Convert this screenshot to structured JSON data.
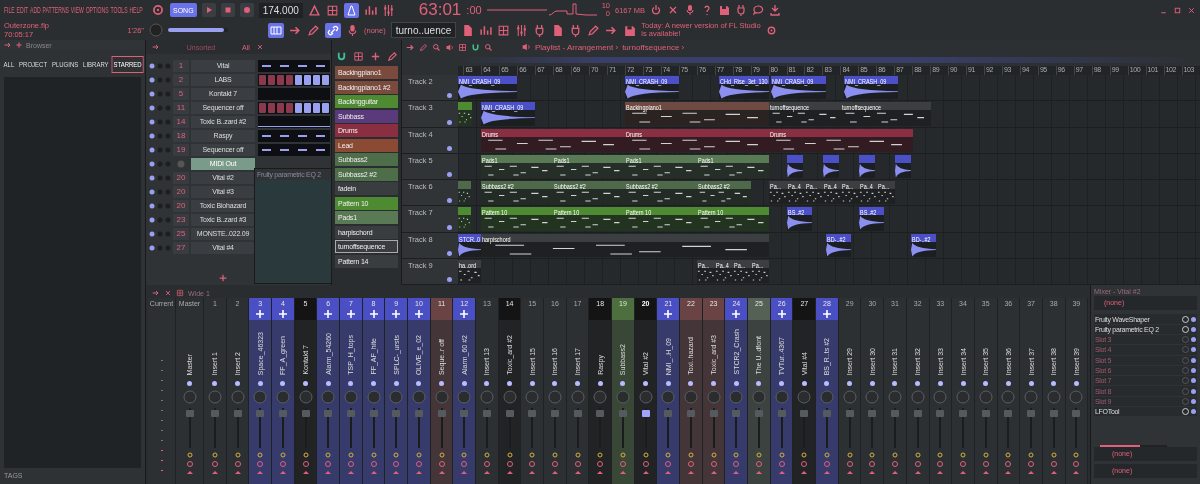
{
  "menu": [
    "FILE",
    "EDIT",
    "ADD",
    "PATTERNS",
    "VIEW",
    "OPTIONS",
    "TOOLS",
    "HELP"
  ],
  "transport": {
    "mode": "SONG",
    "tempo": "174.000"
  },
  "time": {
    "main": "63:01",
    "ticks": ":00"
  },
  "cpu": {
    "value": "10",
    "memory": "6167 MB",
    "polyphony": "0"
  },
  "project": {
    "file": "Outerzone.flp",
    "time": "70:05:17",
    "length": "1'26\""
  },
  "master_volume": {
    "level": 0.93
  },
  "pattern_picker": {
    "channel": "(none)",
    "pattern": "turno..uence"
  },
  "news": "Today: A newer version of FL Studio is available!",
  "browser": {
    "title": "Browser",
    "tabs": [
      {
        "label": "ALL",
        "selected": false
      },
      {
        "label": "PROJECT",
        "selected": false
      },
      {
        "label": "PLUGINS",
        "selected": false
      },
      {
        "label": "LIBRARY",
        "selected": false
      },
      {
        "label": "STARRED",
        "selected": true
      }
    ],
    "footer": "TAGS"
  },
  "rack": {
    "filter": "Unsorted",
    "group": "All",
    "plugin_window": {
      "title": "Fruity parametric EQ 2"
    },
    "channels": [
      {
        "number": "1",
        "name": "Vital",
        "selected": false
      },
      {
        "number": "2",
        "name": "LABS",
        "selected": false
      },
      {
        "number": "5",
        "name": "Kontakt 7",
        "selected": false
      },
      {
        "number": "11",
        "name": "Sequencer off",
        "selected": false
      },
      {
        "number": "14",
        "name": "Toxic B..zard #2",
        "selected": false
      },
      {
        "number": "18",
        "name": "Raspy",
        "selected": false
      },
      {
        "number": "19",
        "name": "Sequencer off",
        "selected": false
      },
      {
        "name": "MIDI Out",
        "selected": true
      },
      {
        "number": "20",
        "name": "Vital #2",
        "selected": false
      },
      {
        "number": "20",
        "name": "Vital #3",
        "selected": false
      },
      {
        "number": "20",
        "name": "Toxic Biohazard",
        "selected": false
      },
      {
        "number": "23",
        "name": "Toxic B..zard #3",
        "selected": false
      },
      {
        "number": "25",
        "name": "MONSTE..022.09",
        "selected": false
      },
      {
        "number": "27",
        "name": "Vital #4",
        "selected": false
      }
    ]
  },
  "patterns": {
    "items": [
      {
        "name": "Backingpiano1",
        "color": "#7a4a3c",
        "selected": false
      },
      {
        "name": "Backingpiano1 #2",
        "color": "#7a4a3c",
        "selected": false
      },
      {
        "name": "Backingguitar",
        "color": "#4e8a32",
        "selected": false
      },
      {
        "name": "Subbass",
        "color": "#5a3a7a",
        "selected": false
      },
      {
        "name": "Drums",
        "color": "#8a2f42",
        "selected": false
      },
      {
        "name": "Lead",
        "color": "#8a4a34",
        "selected": false
      },
      {
        "name": "Subbass2",
        "color": "#4e6e4a",
        "selected": false
      },
      {
        "name": "Subbass2 #2",
        "color": "#4e6e4a",
        "selected": false
      },
      {
        "name": "fadein",
        "color": "#3a3d40",
        "selected": false
      },
      {
        "name": "Pattern 10",
        "color": "#4e8a32",
        "selected": false
      },
      {
        "name": "Pads1",
        "color": "#5a7a56",
        "selected": false
      },
      {
        "name": "harpischord",
        "color": "#3a3d40",
        "selected": false
      },
      {
        "name": "turnoffsequence",
        "color": "#3a3d40",
        "selected": true
      },
      {
        "name": "Pattern 14",
        "color": "#3a3d40",
        "selected": false
      }
    ]
  },
  "playlist": {
    "title": "Playlist - Arrangement ›",
    "pattern": "turnoffsequence ›",
    "ruler": [
      "63",
      "64",
      "65",
      "66",
      "67",
      "68",
      "69",
      "70",
      "71",
      "72",
      "73",
      "74",
      "75",
      "76",
      "77",
      "78",
      "79",
      "80",
      "81",
      "82",
      "83",
      "84",
      "85",
      "86",
      "87",
      "88",
      "89",
      "90",
      "91",
      "92",
      "93",
      "94",
      "95",
      "96",
      "97",
      "98",
      "99",
      "100",
      "101",
      "102",
      "103"
    ],
    "tracks": [
      {
        "name": "Track 2",
        "clips": [
          {
            "kind": "audio",
            "name": "NMI_CRASH_09",
            "color": "#4b4fc8"
          },
          {
            "kind": "audio",
            "name": "NMI_CRASH_09",
            "color": "#4b4fc8"
          },
          {
            "kind": "audio",
            "name": "CHd_Rise_3et_130",
            "color": "#4b4fc8"
          },
          {
            "kind": "audio",
            "name": "NMI_CRASH_09",
            "color": "#4b4fc8"
          },
          {
            "kind": "audio",
            "name": "NMI_CRASH_09",
            "color": "#4b4fc8"
          }
        ]
      },
      {
        "name": "Track 3",
        "clips": [
          {
            "kind": "pattern",
            "color": "#4e8a32"
          },
          {
            "kind": "audio",
            "name": "NMI_CRASH_09",
            "color": "#4b4fc8"
          },
          {
            "kind": "pattern",
            "name": "Backingpiano1",
            "color": "#6e4a42"
          },
          {
            "kind": "pattern",
            "name": "turnoffsequence",
            "color": "#3c3f42"
          },
          {
            "kind": "pattern",
            "name": "turnoffsequence",
            "color": "#3c3f42"
          }
        ]
      },
      {
        "name": "Track 4",
        "clips": [
          {
            "kind": "pattern",
            "name": "Drums",
            "color": "#8a2f42"
          },
          {
            "kind": "pattern",
            "name": "Drums",
            "color": "#8a2f42"
          },
          {
            "kind": "pattern",
            "name": "Drums",
            "color": "#8a2f42"
          }
        ]
      },
      {
        "name": "Track 5",
        "clips": [
          {
            "kind": "pattern",
            "name": "Pads1",
            "color": "#5a7a56"
          },
          {
            "kind": "pattern",
            "name": "Pads1",
            "color": "#5a7a56"
          },
          {
            "kind": "pattern",
            "name": "Pads1",
            "color": "#5a7a56"
          },
          {
            "kind": "pattern",
            "name": "Pads1",
            "color": "#5a7a56"
          },
          {
            "kind": "audio",
            "color": "#4b4fc8"
          },
          {
            "kind": "audio",
            "color": "#4b4fc8"
          },
          {
            "kind": "audio",
            "color": "#4b4fc8"
          },
          {
            "kind": "audio",
            "color": "#4b4fc8"
          }
        ]
      },
      {
        "name": "Track 6",
        "clips": [
          {
            "kind": "pattern",
            "color": "#4e6a4a"
          },
          {
            "kind": "pattern",
            "name": "Subbass2 #2",
            "color": "#4e6a4a"
          },
          {
            "kind": "pattern",
            "name": "Subbass2 #2",
            "color": "#4e6a4a"
          },
          {
            "kind": "pattern",
            "name": "Subbass2 #2",
            "color": "#4e6a4a"
          },
          {
            "kind": "pattern",
            "name": "Subbass2 #2",
            "color": "#4e6a4a"
          },
          {
            "kind": "pattern",
            "name": "Pa...",
            "color": "#3c3f42"
          },
          {
            "kind": "pattern",
            "name": "Pa..4",
            "color": "#3c3f42"
          },
          {
            "kind": "pattern",
            "name": "Pa...",
            "color": "#3c3f42"
          },
          {
            "kind": "pattern",
            "name": "Pa..4",
            "color": "#3c3f42"
          },
          {
            "kind": "pattern",
            "name": "Pa...",
            "color": "#3c3f42"
          },
          {
            "kind": "pattern",
            "name": "Pa..4",
            "color": "#3c3f42"
          },
          {
            "kind": "pattern",
            "name": "Pa...",
            "color": "#3c3f42"
          }
        ]
      },
      {
        "name": "Track 7",
        "clips": [
          {
            "kind": "pattern",
            "color": "#4e8a32"
          },
          {
            "kind": "pattern",
            "name": "Pattern 10",
            "color": "#4e8a32"
          },
          {
            "kind": "pattern",
            "name": "Pattern 10",
            "color": "#4e8a32"
          },
          {
            "kind": "pattern",
            "name": "Pattern 10",
            "color": "#4e8a32"
          },
          {
            "kind": "pattern",
            "name": "Pattern 10",
            "color": "#4e8a32"
          },
          {
            "kind": "audio",
            "name": "BS..#2",
            "color": "#4b4fc8"
          },
          {
            "kind": "audio",
            "name": "BS..#2",
            "color": "#4b4fc8"
          }
        ]
      },
      {
        "name": "Track 8",
        "clips": [
          {
            "kind": "audio",
            "name": "STCR..0",
            "color": "#4b4fc8"
          },
          {
            "kind": "pattern",
            "name": "harpischord",
            "color": "#3c3f42"
          },
          {
            "kind": "audio",
            "name": "BD-..#2",
            "color": "#4b4fc8"
          },
          {
            "kind": "audio",
            "name": "BD-..#2",
            "color": "#4b4fc8"
          }
        ]
      },
      {
        "name": "Track 9",
        "clips": [
          {
            "kind": "pattern",
            "name": "ha..ord",
            "color": "#3c3f42"
          },
          {
            "kind": "pattern",
            "name": "Pa...",
            "color": "#3c3f42"
          },
          {
            "kind": "pattern",
            "name": "Pa..4",
            "color": "#3c3f42"
          },
          {
            "kind": "pattern",
            "name": "Pa...",
            "color": "#3c3f42"
          },
          {
            "kind": "pattern",
            "name": "Pa...",
            "color": "#3c3f42"
          }
        ]
      }
    ]
  },
  "mixer": {
    "layout": "Wide 1",
    "current": "Current",
    "master": {
      "label": "Master",
      "name": "Master"
    },
    "inserts": [
      {
        "number": "1",
        "name": "Insert 1",
        "routed": false,
        "selected": false
      },
      {
        "number": "2",
        "name": "Insert 2",
        "routed": false,
        "selected": false
      },
      {
        "number": "3",
        "name": "Space_46323",
        "color": "#4a4fc4",
        "routed": true,
        "selected": false
      },
      {
        "number": "4",
        "name": "FF_A_green",
        "color": "#4a4fc4",
        "routed": true,
        "selected": false
      },
      {
        "number": "5",
        "name": "Kontakt 7",
        "color": "#141414",
        "routed": false,
        "selected": false
      },
      {
        "number": "6",
        "name": "Alarm_54260",
        "color": "#4a4fc4",
        "routed": true,
        "selected": false
      },
      {
        "number": "7",
        "name": "TSP_H_tops",
        "color": "#4a4fc4",
        "routed": true,
        "selected": false
      },
      {
        "number": "8",
        "name": "FF_AF_hite",
        "color": "#4a4fc4",
        "routed": true,
        "selected": false
      },
      {
        "number": "9",
        "name": "SPLC-_ursts",
        "color": "#4a4fc4",
        "routed": true,
        "selected": false
      },
      {
        "number": "10",
        "name": "OLIVE_e_02",
        "color": "#4a4fc4",
        "routed": true,
        "selected": false
      },
      {
        "number": "11",
        "name": "Seque..r off",
        "color": "#6a4444",
        "routed": false,
        "selected": false
      },
      {
        "number": "12",
        "name": "Alarm_60 #2",
        "color": "#4a4fc4",
        "routed": true,
        "selected": false
      },
      {
        "number": "13",
        "name": "Insert 13",
        "routed": false,
        "selected": false
      },
      {
        "number": "14",
        "name": "Toxic_ard #2",
        "color": "#141414",
        "routed": false,
        "selected": false
      },
      {
        "number": "15",
        "name": "Insert 15",
        "routed": false,
        "selected": false
      },
      {
        "number": "16",
        "name": "Insert 16",
        "routed": false,
        "selected": false
      },
      {
        "number": "17",
        "name": "Insert 17",
        "routed": false,
        "selected": false
      },
      {
        "number": "18",
        "name": "Raspy",
        "color": "#141414",
        "routed": false,
        "selected": false
      },
      {
        "number": "19",
        "name": "Subbass2",
        "color": "#4d6e3e",
        "routed": false,
        "selected": false
      },
      {
        "number": "20",
        "name": "Vital #2",
        "color": "#141414",
        "routed": false,
        "selected": true
      },
      {
        "number": "21",
        "name": "NMI_..H_09",
        "color": "#4a4fc4",
        "routed": true,
        "selected": false
      },
      {
        "number": "22",
        "name": "Toxi..hazard",
        "color": "#6a4444",
        "routed": false,
        "selected": false
      },
      {
        "number": "23",
        "name": "Toxic_ard #3",
        "color": "#6a4444",
        "routed": false,
        "selected": false
      },
      {
        "number": "24",
        "name": "STCR2_Crash",
        "color": "#4a4fc4",
        "routed": true,
        "selected": false
      },
      {
        "number": "25",
        "name": "The U..dfont",
        "color": "#556155",
        "routed": false,
        "selected": false
      },
      {
        "number": "26",
        "name": "TVTur..4367",
        "color": "#4a4fc4",
        "routed": true,
        "selected": false
      },
      {
        "number": "27",
        "name": "Vital #4",
        "color": "#141414",
        "routed": false,
        "selected": false
      },
      {
        "number": "28",
        "name": "BS_R..ts #2",
        "color": "#4a4fc4",
        "routed": true,
        "selected": false
      },
      {
        "number": "29",
        "name": "Insert 29",
        "routed": false,
        "selected": false
      },
      {
        "number": "30",
        "name": "Insert 30",
        "routed": false,
        "selected": false
      },
      {
        "number": "31",
        "name": "Insert 31",
        "routed": false,
        "selected": false
      },
      {
        "number": "32",
        "name": "Insert 32",
        "routed": false,
        "selected": false
      },
      {
        "number": "33",
        "name": "Insert 33",
        "routed": false,
        "selected": false
      },
      {
        "number": "34",
        "name": "Insert 34",
        "routed": false,
        "selected": false
      },
      {
        "number": "35",
        "name": "Insert 35",
        "routed": false,
        "selected": false
      },
      {
        "number": "36",
        "name": "Insert 36",
        "routed": false,
        "selected": false
      },
      {
        "number": "37",
        "name": "Insert 37",
        "routed": false,
        "selected": false
      },
      {
        "number": "38",
        "name": "Insert 38",
        "routed": false,
        "selected": false
      },
      {
        "number": "39",
        "name": "Insert 39",
        "routed": false,
        "selected": false
      }
    ]
  },
  "fx": {
    "title": "Mixer - Vital #2",
    "preset": "(none)",
    "slots": [
      {
        "name": "Fruity WaveShaper",
        "kind": "plugin"
      },
      {
        "name": "Fruity parametric EQ 2",
        "kind": "plugin"
      },
      {
        "name": "Slot 3",
        "kind": "empty"
      },
      {
        "name": "Slot 4",
        "kind": "empty"
      },
      {
        "name": "Slot 5",
        "kind": "empty"
      },
      {
        "name": "Slot 6",
        "kind": "empty"
      },
      {
        "name": "Slot 7",
        "kind": "empty"
      },
      {
        "name": "Slot 8",
        "kind": "empty"
      },
      {
        "name": "Slot 9",
        "kind": "empty"
      },
      {
        "name": "LFOTool",
        "kind": "plugin"
      }
    ],
    "mix": {
      "level": 0.6
    },
    "input": "(none)",
    "output": "(none)"
  }
}
